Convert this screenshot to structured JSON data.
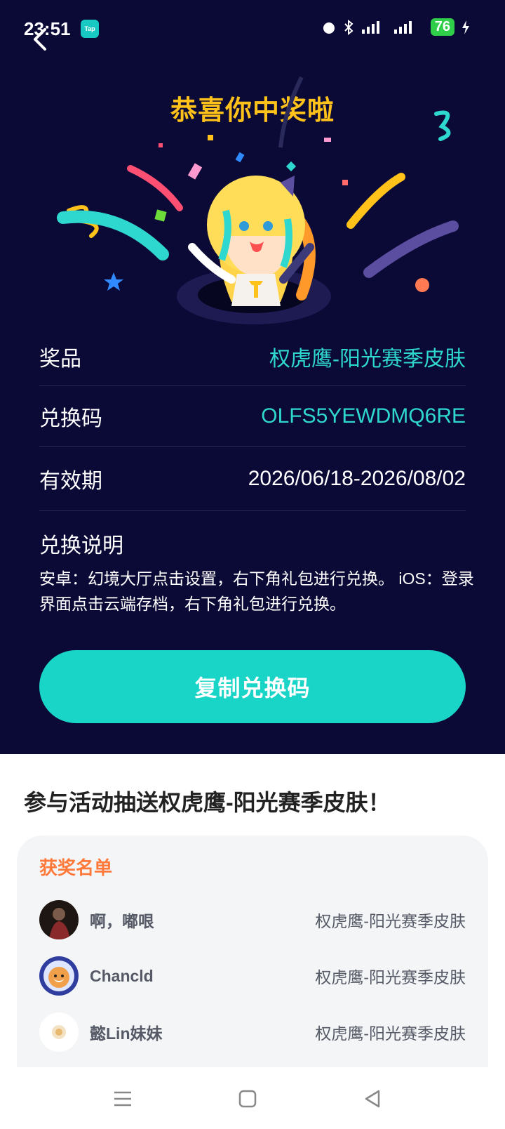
{
  "status_bar": {
    "time": "23:51",
    "app_badge": "Tap",
    "battery": "76"
  },
  "hero": {
    "title": "恭喜你中奖啦"
  },
  "prize_info": {
    "rows": [
      {
        "label": "奖品",
        "value": "权虎鹰-阳光赛季皮肤"
      },
      {
        "label": "兑换码",
        "value": "OLFS5YEWDMQ6RE"
      },
      {
        "label": "有效期",
        "value": "2026/06/18-2026/08/02"
      }
    ],
    "note_title": "兑换说明",
    "note_text": "安卓：幻境大厅点击设置，右下角礼包进行兑换。 iOS：登录界面点击云端存档，右下角礼包进行兑换。",
    "copy_button": "复制兑换码"
  },
  "activity": {
    "title": "参与活动抽送权虎鹰-阳光赛季皮肤！",
    "winners_title": "获奖名单",
    "winners": [
      {
        "name": "啊，嘟哏",
        "prize": "权虎鹰-阳光赛季皮肤"
      },
      {
        "name": "Chancld",
        "prize": "权虎鹰-阳光赛季皮肤"
      },
      {
        "name": "懿Lin妹妹",
        "prize": "权虎鹰-阳光赛季皮肤"
      }
    ]
  },
  "colors": {
    "background_dark": "#0b0936",
    "accent_teal": "#19d5c7",
    "title_yellow": "#ffc21a",
    "winners_orange": "#ff7a3a"
  },
  "icons": [
    "back-arrow-icon",
    "alarm-icon",
    "bluetooth-icon",
    "signal-icon",
    "battery-icon",
    "menu-nav-icon",
    "home-nav-icon",
    "back-nav-icon"
  ]
}
